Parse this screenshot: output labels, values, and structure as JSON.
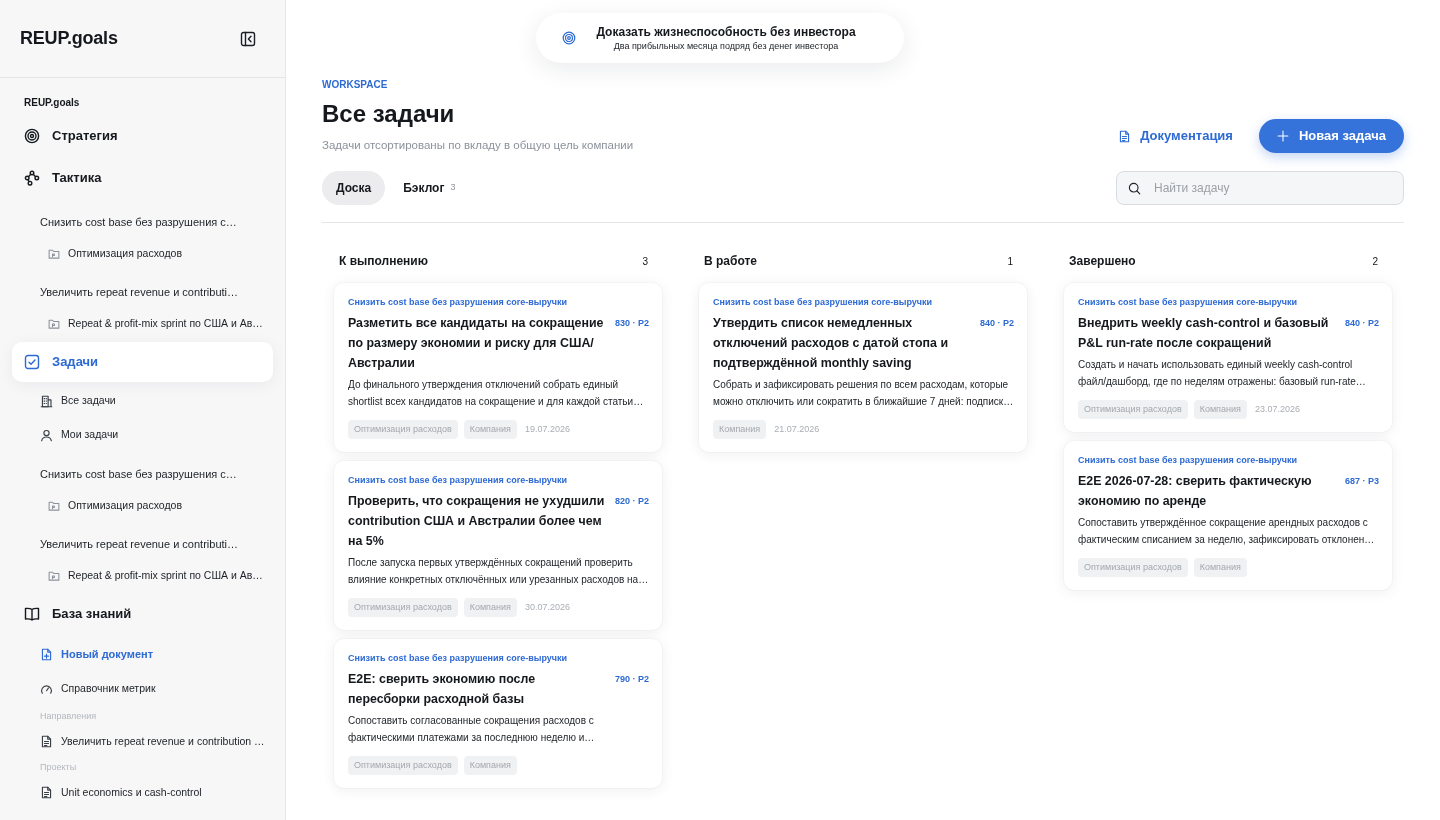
{
  "sidebar": {
    "brand": "REUP.goals",
    "workspace": "REUP.goals",
    "sections": [
      {
        "kind": "strategy",
        "label": "Стратегия",
        "selected": false
      },
      {
        "kind": "tactics",
        "label": "Тактика",
        "selected": false,
        "children": [
          {
            "kind": "goal",
            "label": "Снизить cost base без разрушения с…",
            "children": [
              {
                "label": "Оптимизация расходов"
              }
            ]
          },
          {
            "kind": "goal",
            "label": "Увеличить repeat revenue и contributi…",
            "children": [
              {
                "label": "Repeat & profit-mix sprint по США и Ав…"
              }
            ]
          }
        ]
      },
      {
        "kind": "tasks",
        "label": "Задачи",
        "selected": true,
        "children": [
          {
            "kind": "team",
            "label": "Все задачи"
          },
          {
            "kind": "personal",
            "label": "Мои задачи"
          },
          {
            "kind": "goal",
            "label": "Снизить cost base без разрушения с…",
            "children": [
              {
                "label": "Оптимизация расходов"
              }
            ]
          },
          {
            "kind": "goal",
            "label": "Увеличить repeat revenue и contributi…",
            "children": [
              {
                "label": "Repeat & profit-mix sprint по США и Ав…"
              }
            ]
          }
        ]
      },
      {
        "kind": "knowledge",
        "label": "База знаний",
        "selected": false,
        "children": [
          {
            "kind": "create",
            "label": "Новый документ"
          },
          {
            "kind": "metrics",
            "label": "Справочник метрик"
          },
          {
            "kind": "group",
            "label": "Направления",
            "children": [
              {
                "label": "Увеличить repeat revenue и contribution …"
              }
            ]
          },
          {
            "kind": "group",
            "label": "Проекты",
            "children": [
              {
                "label": "Unit economics и cash-control"
              }
            ]
          }
        ]
      }
    ]
  },
  "goal_banner": {
    "title": "Доказать жизнеспособность без инвестора",
    "subtitle": "Два прибыльных месяца подряд без денег инвестора"
  },
  "header": {
    "eyebrow": "WORKSPACE",
    "title": "Все задачи",
    "subtitle": "Задачи отсортированы по вкладу в общую цель компании",
    "docs_link": "Документация",
    "new_button": "Новая задача"
  },
  "tabs": [
    {
      "label": "Доска",
      "selected": true
    },
    {
      "label": "Бэклог",
      "count": "3",
      "selected": false
    }
  ],
  "search": {
    "placeholder": "Найти задачу"
  },
  "columns": [
    {
      "title": "К выполнению",
      "count": "3",
      "cards": [
        {
          "goal": "Снизить cost base без разрушения core-выручки",
          "title": "Разметить все кандидаты на сокращение по размеру экономии и риску для США/Австралии",
          "score": "830 · P2",
          "description": "До финального утверждения отключений собрать единый shortlist всех кандидатов на сокращение и для каждой статьи…",
          "tags": [
            "Оптимизация расходов",
            "Компания"
          ],
          "date": "19.07.2026"
        },
        {
          "goal": "Снизить cost base без разрушения core-выручки",
          "title": "Проверить, что сокращения не ухудшили contribution США и Австралии более чем на 5%",
          "score": "820 · P2",
          "description": "После запуска первых утверждённых сокращений проверить влияние конкретных отключённых или урезанных расходов на…",
          "tags": [
            "Оптимизация расходов",
            "Компания"
          ],
          "date": "30.07.2026"
        },
        {
          "goal": "Снизить cost base без разрушения core-выручки",
          "title": "E2E: сверить экономию после пересборки расходной базы",
          "score": "790 · P2",
          "description": "Сопоставить согласованные сокращения расходов с фактическими платежами за последнюю неделю и…",
          "tags": [
            "Оптимизация расходов",
            "Компания"
          ]
        }
      ]
    },
    {
      "title": "В работе",
      "count": "1",
      "cards": [
        {
          "goal": "Снизить cost base без разрушения core-выручки",
          "title": "Утвердить список немедленных отключений расходов с датой стопа и подтверждённой monthly saving",
          "score": "840 · P2",
          "description": "Собрать и зафиксировать решения по всем расходам, которые можно отключить или сократить в ближайшие 7 дней: подписк…",
          "tags": [
            "Компания"
          ],
          "date": "21.07.2026"
        }
      ]
    },
    {
      "title": "Завершено",
      "count": "2",
      "cards": [
        {
          "goal": "Снизить cost base без разрушения core-выручки",
          "title": "Внедрить weekly cash-control и базовый P&L run-rate после сокращений",
          "score": "840 · P2",
          "description": "Создать и начать использовать единый weekly cash-control файл/дашборд, где по неделям отражены: базовый run-rate…",
          "tags": [
            "Оптимизация расходов",
            "Компания"
          ],
          "date": "23.07.2026"
        },
        {
          "goal": "Снизить cost base без разрушения core-выручки",
          "title": "E2E 2026-07-28: сверить фактическую экономию по аренде",
          "score": "687 · P3",
          "description": "Сопоставить утверждённое сокращение арендных расходов с фактическим списанием за неделю, зафиксировать отклонен…",
          "tags": [
            "Оптимизация расходов",
            "Компания"
          ]
        }
      ]
    }
  ]
}
